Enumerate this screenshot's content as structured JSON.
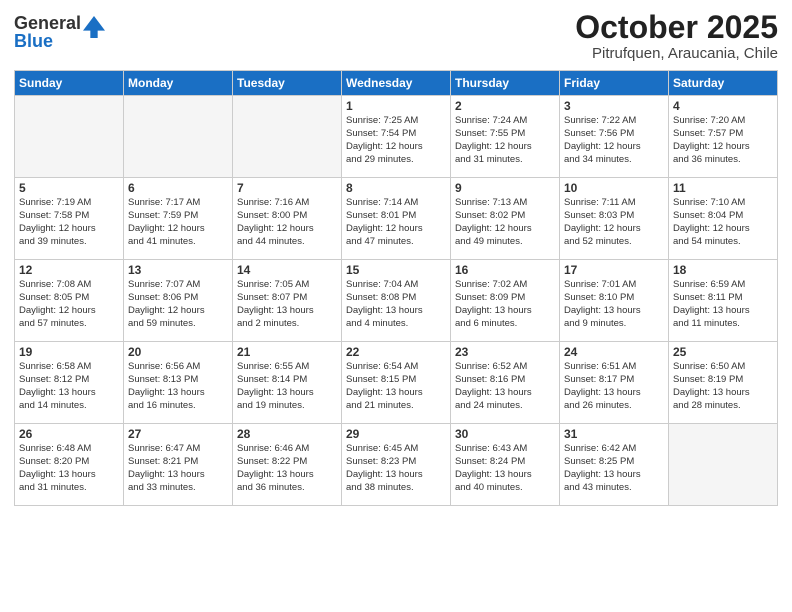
{
  "logo": {
    "general": "General",
    "blue": "Blue"
  },
  "title": "October 2025",
  "subtitle": "Pitrufquen, Araucania, Chile",
  "headers": [
    "Sunday",
    "Monday",
    "Tuesday",
    "Wednesday",
    "Thursday",
    "Friday",
    "Saturday"
  ],
  "weeks": [
    [
      {
        "day": "",
        "info": ""
      },
      {
        "day": "",
        "info": ""
      },
      {
        "day": "",
        "info": ""
      },
      {
        "day": "1",
        "info": "Sunrise: 7:25 AM\nSunset: 7:54 PM\nDaylight: 12 hours\nand 29 minutes."
      },
      {
        "day": "2",
        "info": "Sunrise: 7:24 AM\nSunset: 7:55 PM\nDaylight: 12 hours\nand 31 minutes."
      },
      {
        "day": "3",
        "info": "Sunrise: 7:22 AM\nSunset: 7:56 PM\nDaylight: 12 hours\nand 34 minutes."
      },
      {
        "day": "4",
        "info": "Sunrise: 7:20 AM\nSunset: 7:57 PM\nDaylight: 12 hours\nand 36 minutes."
      }
    ],
    [
      {
        "day": "5",
        "info": "Sunrise: 7:19 AM\nSunset: 7:58 PM\nDaylight: 12 hours\nand 39 minutes."
      },
      {
        "day": "6",
        "info": "Sunrise: 7:17 AM\nSunset: 7:59 PM\nDaylight: 12 hours\nand 41 minutes."
      },
      {
        "day": "7",
        "info": "Sunrise: 7:16 AM\nSunset: 8:00 PM\nDaylight: 12 hours\nand 44 minutes."
      },
      {
        "day": "8",
        "info": "Sunrise: 7:14 AM\nSunset: 8:01 PM\nDaylight: 12 hours\nand 47 minutes."
      },
      {
        "day": "9",
        "info": "Sunrise: 7:13 AM\nSunset: 8:02 PM\nDaylight: 12 hours\nand 49 minutes."
      },
      {
        "day": "10",
        "info": "Sunrise: 7:11 AM\nSunset: 8:03 PM\nDaylight: 12 hours\nand 52 minutes."
      },
      {
        "day": "11",
        "info": "Sunrise: 7:10 AM\nSunset: 8:04 PM\nDaylight: 12 hours\nand 54 minutes."
      }
    ],
    [
      {
        "day": "12",
        "info": "Sunrise: 7:08 AM\nSunset: 8:05 PM\nDaylight: 12 hours\nand 57 minutes."
      },
      {
        "day": "13",
        "info": "Sunrise: 7:07 AM\nSunset: 8:06 PM\nDaylight: 12 hours\nand 59 minutes."
      },
      {
        "day": "14",
        "info": "Sunrise: 7:05 AM\nSunset: 8:07 PM\nDaylight: 13 hours\nand 2 minutes."
      },
      {
        "day": "15",
        "info": "Sunrise: 7:04 AM\nSunset: 8:08 PM\nDaylight: 13 hours\nand 4 minutes."
      },
      {
        "day": "16",
        "info": "Sunrise: 7:02 AM\nSunset: 8:09 PM\nDaylight: 13 hours\nand 6 minutes."
      },
      {
        "day": "17",
        "info": "Sunrise: 7:01 AM\nSunset: 8:10 PM\nDaylight: 13 hours\nand 9 minutes."
      },
      {
        "day": "18",
        "info": "Sunrise: 6:59 AM\nSunset: 8:11 PM\nDaylight: 13 hours\nand 11 minutes."
      }
    ],
    [
      {
        "day": "19",
        "info": "Sunrise: 6:58 AM\nSunset: 8:12 PM\nDaylight: 13 hours\nand 14 minutes."
      },
      {
        "day": "20",
        "info": "Sunrise: 6:56 AM\nSunset: 8:13 PM\nDaylight: 13 hours\nand 16 minutes."
      },
      {
        "day": "21",
        "info": "Sunrise: 6:55 AM\nSunset: 8:14 PM\nDaylight: 13 hours\nand 19 minutes."
      },
      {
        "day": "22",
        "info": "Sunrise: 6:54 AM\nSunset: 8:15 PM\nDaylight: 13 hours\nand 21 minutes."
      },
      {
        "day": "23",
        "info": "Sunrise: 6:52 AM\nSunset: 8:16 PM\nDaylight: 13 hours\nand 24 minutes."
      },
      {
        "day": "24",
        "info": "Sunrise: 6:51 AM\nSunset: 8:17 PM\nDaylight: 13 hours\nand 26 minutes."
      },
      {
        "day": "25",
        "info": "Sunrise: 6:50 AM\nSunset: 8:19 PM\nDaylight: 13 hours\nand 28 minutes."
      }
    ],
    [
      {
        "day": "26",
        "info": "Sunrise: 6:48 AM\nSunset: 8:20 PM\nDaylight: 13 hours\nand 31 minutes."
      },
      {
        "day": "27",
        "info": "Sunrise: 6:47 AM\nSunset: 8:21 PM\nDaylight: 13 hours\nand 33 minutes."
      },
      {
        "day": "28",
        "info": "Sunrise: 6:46 AM\nSunset: 8:22 PM\nDaylight: 13 hours\nand 36 minutes."
      },
      {
        "day": "29",
        "info": "Sunrise: 6:45 AM\nSunset: 8:23 PM\nDaylight: 13 hours\nand 38 minutes."
      },
      {
        "day": "30",
        "info": "Sunrise: 6:43 AM\nSunset: 8:24 PM\nDaylight: 13 hours\nand 40 minutes."
      },
      {
        "day": "31",
        "info": "Sunrise: 6:42 AM\nSunset: 8:25 PM\nDaylight: 13 hours\nand 43 minutes."
      },
      {
        "day": "",
        "info": ""
      }
    ]
  ]
}
